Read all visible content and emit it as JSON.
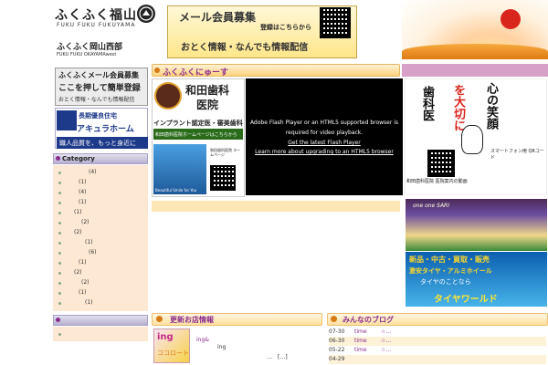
{
  "header": {
    "logo_main": "ふくふく福山",
    "logo_sub": "FUKU FUKU FUKUYAMA",
    "logo2": "ふくふく岡山西部",
    "logo2_sub": "FUKU FUKU OKAYAMAwest",
    "banner_title": "メール会員募集",
    "banner_register": "登録はこちらから",
    "banner_bottom": "おとく情報・なんでも情報配信"
  },
  "sidebar": {
    "mail_banner": {
      "line1": "ふくふくメール会員募集",
      "line2": "ここを押して簡単登録",
      "line3": "おとく情報・なんでも情報配信"
    },
    "akira_banner": {
      "line1": "長期優良住宅",
      "line2": "アキュラホーム",
      "line3": "職人品質を、もっと身近に"
    },
    "category_title": "Category",
    "categories": [
      {
        "label": "(4)"
      },
      {
        "label": "(1)"
      },
      {
        "label": "(4)"
      },
      {
        "label": "(1)"
      },
      {
        "label": "(1)"
      },
      {
        "label": "(2)"
      },
      {
        "label": "(2)"
      },
      {
        "label": "(1)"
      },
      {
        "label": "(6)"
      },
      {
        "label": "(1)"
      },
      {
        "label": "(2)"
      },
      {
        "label": "(2)"
      },
      {
        "label": "(1)"
      },
      {
        "label": "(1)"
      }
    ]
  },
  "news": {
    "title": "ふくふくにゅーす"
  },
  "wada": {
    "name_line1": "和田歯科",
    "name_line2": "医院",
    "implant": "インプラント認定医・審美歯科",
    "link": "和田歯科医院ホームページはこちらから",
    "qr_text": "和田歯科医院 ホームページ",
    "footer_caption": "Beautiful Smile for You"
  },
  "flash": {
    "line1": "Adobe Flash Player or an HTML5 supported browser is",
    "line2": "required for video playback.",
    "link1": "Get the latest Flash Player",
    "link2": "Learn more about upgrading to an HTML5 browser"
  },
  "right_art": {
    "col1": "心の笑顔",
    "col2": "を大切に",
    "col3": "歯科医",
    "smartphone_text": "スマートフォン用 QRコード",
    "caption": "和田歯科医院 医院案内の動画"
  },
  "right_banners": {
    "banner1_text": "one one SARI",
    "tire_line1": "新品・中古・買取・販売",
    "tire_line2": "激安タイヤ・アルミホイール",
    "tire_line3": "タイヤのことなら",
    "tire_line4": "タイヤワールド"
  },
  "stores": {
    "title": "更新お店情報",
    "thumb_line1": "ing",
    "thumb_line2": "ココロート",
    "item_link": "ing&",
    "item_sub": "ing",
    "more": "…　[…]"
  },
  "blog": {
    "title": "みんなのブログ",
    "rows": [
      {
        "date": "07-30",
        "title": "time",
        "tail": "☆..."
      },
      {
        "date": "06-30",
        "title": "time",
        "tail": "☆..."
      },
      {
        "date": "05-22",
        "title": "time",
        "tail": "☆..."
      },
      {
        "date": "04-29",
        "title": "",
        "tail": ""
      }
    ]
  },
  "colors": {
    "accent_purple": "#8a2c8f",
    "accent_orange": "#d67b16",
    "tire_yellow": "#ffe632"
  }
}
